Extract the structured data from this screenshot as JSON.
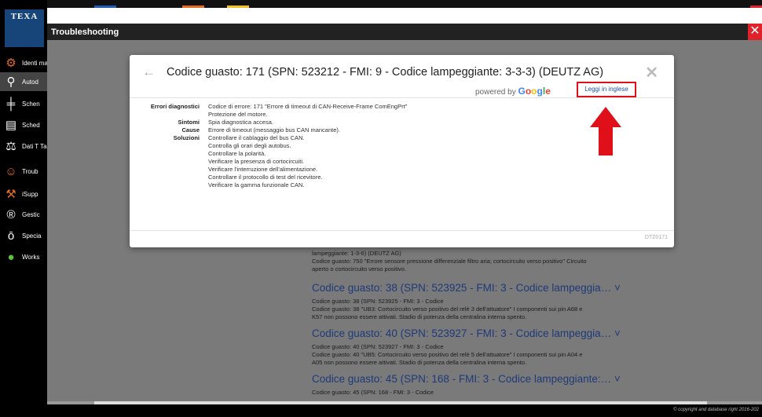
{
  "app": {
    "logo_text": "TEXA",
    "window_title": "Troubleshooting",
    "close_glyph": "✕",
    "copyright": "© copyright and database right 2016-202"
  },
  "colors": {
    "brand_blue": "#17457a",
    "close_red": "#e0222a",
    "highlight_red": "#e0101a",
    "link_blue": "#1e3a78"
  },
  "top_strip": [
    {
      "color": "#1f5db7"
    },
    {
      "color": "#e46a1e"
    },
    {
      "color": "#f3c31a"
    },
    {
      "color": "#e0222a"
    }
  ],
  "sidebar": {
    "items": [
      {
        "icon": "identification-icon",
        "glyph": "⚙",
        "label": "Identi manu"
      },
      {
        "icon": "vehicle-icon",
        "glyph": "⚲",
        "label": "Autod"
      },
      {
        "icon": "schematics-icon",
        "glyph": "╪",
        "label": "Schen"
      },
      {
        "icon": "datasheet-icon",
        "glyph": "▤",
        "label": "Sched"
      },
      {
        "icon": "data-icon",
        "glyph": "⚖",
        "label": "Dati T Taglia"
      },
      {
        "icon": "troubleshooting-icon",
        "glyph": "☺",
        "label": "Troub"
      },
      {
        "icon": "support-icon",
        "glyph": "⚒",
        "label": "iSupp"
      },
      {
        "icon": "management-icon",
        "glyph": "®",
        "label": "Gestic"
      },
      {
        "icon": "special-icon",
        "glyph": "ō",
        "label": "Specia"
      },
      {
        "icon": "workshop-icon",
        "glyph": "●",
        "label": "Works"
      }
    ]
  },
  "background": {
    "first_block": {
      "line1": "lampeggiante: 1-3-6) (DEUTZ AG)",
      "line2": "Codice guasto: 750 \"Errore sensore pressione differenziale filtro aria; cortocircuito verso positivo\" Circuito",
      "line3": "aperto o cortocircuito verso positivo."
    },
    "blocks": [
      {
        "title": "Codice guasto: 38 (SPN: 523925 - FMI: 3 - Codice lampeggia… ˅",
        "line1": "Codice guasto: 38 (SPN: 523925 - FMI: 3 - Codice",
        "line2": "Codice guasto: 38 \"UB3: Cortocircuito verso positivo del relè 3 dell'attuatore\" I componenti sui pin A68 e",
        "line3": "K57 non possono essere attivati. Stadio di potenza della centralina interna spento."
      },
      {
        "title": "Codice guasto: 40 (SPN: 523927 - FMI: 3 - Codice lampeggia… ˅",
        "line1": "Codice guasto: 40 (SPN: 523927 - FMI: 3 - Codice",
        "line2": "Codice guasto: 40 \"UB5: Cortocircuito verso positivo del relè 5 dell'attuatore\" I componenti sui pin A04 e",
        "line3": "A05 non possono essere attivati. Stadio di potenza della centralina interna spento."
      },
      {
        "title": "Codice guasto: 45 (SPN: 168 - FMI: 3 - Codice lampeggiante:… ˅",
        "line1": "Codice guasto: 45 (SPN: 168 - FMI: 3 - Codice",
        "line2": "",
        "line3": ""
      }
    ]
  },
  "modal": {
    "back_glyph": "←",
    "title": "Codice guasto: 171 (SPN: 523212 - FMI: 9 - Codice lampeggiante: 3-3-3) (DEUTZ AG)",
    "close_glyph": "✕",
    "powered_by": "powered by",
    "google": [
      "G",
      "o",
      "o",
      "g",
      "l",
      "e"
    ],
    "translate_button": "Leggi in inglese",
    "footer_code": "DTZ0171",
    "details": [
      {
        "key": "Errori diagnostici",
        "value": "Codice di errore: 171 \"Errore di timeout di CAN-Receive-Frame ComEngPrt\""
      },
      {
        "key": "",
        "value": "Protezione del motore."
      },
      {
        "key": "Sintomi",
        "value": "Spia diagnostica accesa."
      },
      {
        "key": "Cause",
        "value": "Errore di timeout (messaggio bus CAN mancante)."
      },
      {
        "key": "Soluzioni",
        "value": "Controllare il cablaggio del bus CAN."
      },
      {
        "key": "",
        "value": "Controlla gli orari degli autobus."
      },
      {
        "key": "",
        "value": "Controllare la polarità."
      },
      {
        "key": "",
        "value": "Verificare la presenza di cortocircuiti."
      },
      {
        "key": "",
        "value": "Verificare l'interruzione dell'alimentazione."
      },
      {
        "key": "",
        "value": "Controllare il protocollo di test del ricevitore."
      },
      {
        "key": "",
        "value": "Verificare la gamma funzionale CAN."
      }
    ]
  }
}
